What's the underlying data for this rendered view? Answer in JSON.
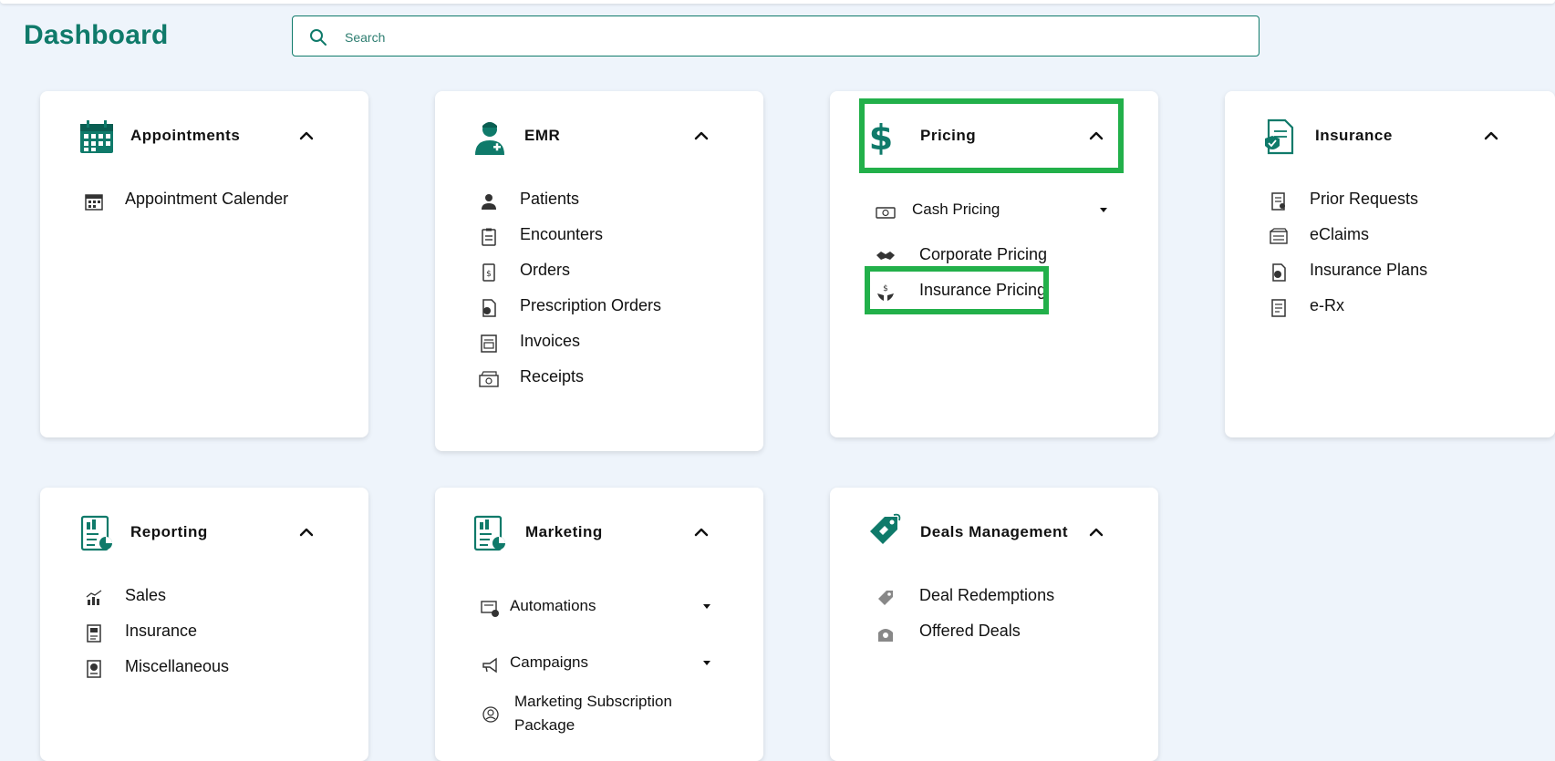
{
  "header": {
    "title": "Dashboard",
    "search_placeholder": "Search"
  },
  "colors": {
    "brand": "#0f7a6a",
    "highlight": "#22b04a",
    "background": "#eef4fb"
  },
  "cards": {
    "appointments": {
      "title": "Appointments",
      "icon": "calendar-icon",
      "items": [
        "Appointment Calender"
      ]
    },
    "emr": {
      "title": "EMR",
      "icon": "doctor-icon",
      "items": [
        "Patients",
        "Encounters",
        "Orders",
        "Prescription Orders",
        "Invoices",
        "Receipts"
      ]
    },
    "pricing": {
      "title": "Pricing",
      "icon": "dollar-icon",
      "items": [
        "Cash Pricing",
        "Corporate Pricing",
        "Insurance Pricing"
      ]
    },
    "insurance": {
      "title": "Insurance",
      "icon": "insurance-document-icon",
      "items": [
        "Prior Requests",
        "eClaims",
        "Insurance Plans",
        "e-Rx"
      ]
    },
    "reporting": {
      "title": "Reporting",
      "icon": "report-icon",
      "items": [
        "Sales",
        "Insurance",
        "Miscellaneous"
      ]
    },
    "marketing": {
      "title": "Marketing",
      "icon": "report-icon",
      "items": [
        "Automations",
        "Campaigns",
        "Marketing Subscription",
        "Package"
      ]
    },
    "deals": {
      "title": "Deals Management",
      "icon": "tag-icon",
      "items": [
        "Deal Redemptions",
        "Offered Deals"
      ]
    }
  }
}
